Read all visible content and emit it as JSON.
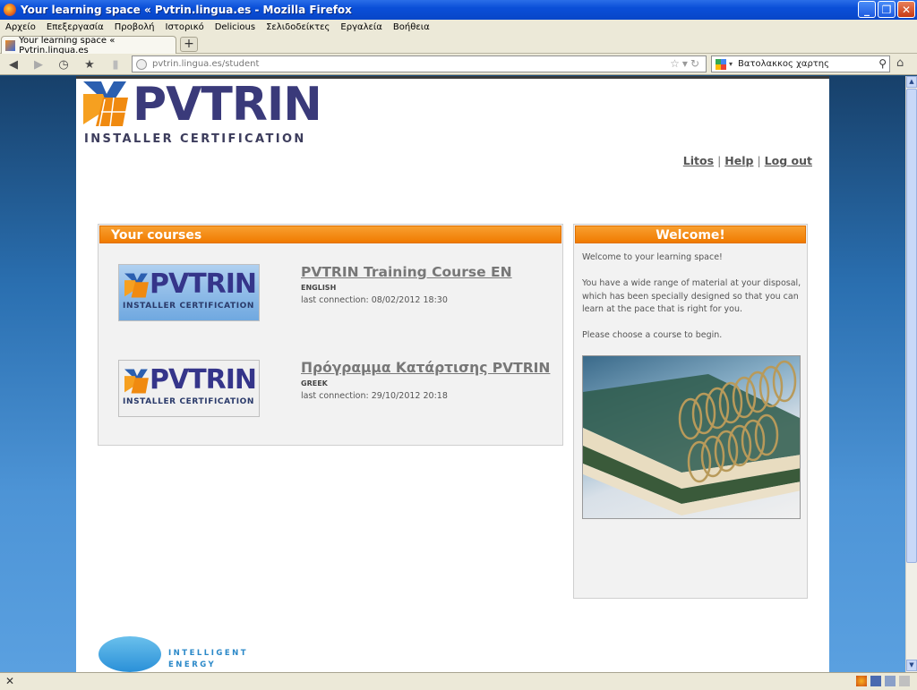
{
  "window": {
    "title": "Your learning space « Pvtrin.lingua.es - Mozilla Firefox",
    "buttons": {
      "minimize": "_",
      "maximize": "❐",
      "close": "✕"
    }
  },
  "menu": [
    "Αρχείο",
    "Επεξεργασία",
    "Προβολή",
    "Ιστορικό",
    "Delicious",
    "Σελιδοδείκτες",
    "Εργαλεία",
    "Βοήθεια"
  ],
  "tabs": {
    "active_label": "Your learning space « Pvtrin.lingua.es",
    "new_tab": "+"
  },
  "nav": {
    "url": "pvtrin.lingua.es/student",
    "search_value": "Βατολακκος χαρτης"
  },
  "logo": {
    "word": "PVTRIN",
    "subtitle": "INSTALLER CERTIFICATION"
  },
  "userlinks": {
    "user": "Litos",
    "help": "Help",
    "logout": "Log out",
    "sep": "|"
  },
  "courses_panel": {
    "title": "Your courses",
    "courses": [
      {
        "title": "PVTRIN Training Course EN",
        "language": "English",
        "last_connection": "last connection: 08/02/2012 18:30"
      },
      {
        "title": "Πρόγραμμα Κατάρτισης PVTRIN",
        "language": "Greek",
        "last_connection": "last connection: 29/10/2012 20:18"
      }
    ]
  },
  "welcome_panel": {
    "title": "Welcome!",
    "p1": "Welcome to your learning space!",
    "p2": "You have a wide range of material at your disposal, which has been specially designed so that you can learn at the pace that is right for you.",
    "p3": "Please choose a course to begin."
  },
  "footer": {
    "line1": "INTELLIGENT",
    "line2": "ENERGY"
  },
  "colors": {
    "accent_orange": "#f07a00",
    "logo_navy": "#3a3a7a",
    "title_bar": "#0a4fd8"
  },
  "icons": [
    "firefox-icon",
    "back-icon",
    "forward-icon",
    "history-icon",
    "bookmarks-icon",
    "home-icon",
    "search-icon",
    "star-icon",
    "reload-icon"
  ]
}
